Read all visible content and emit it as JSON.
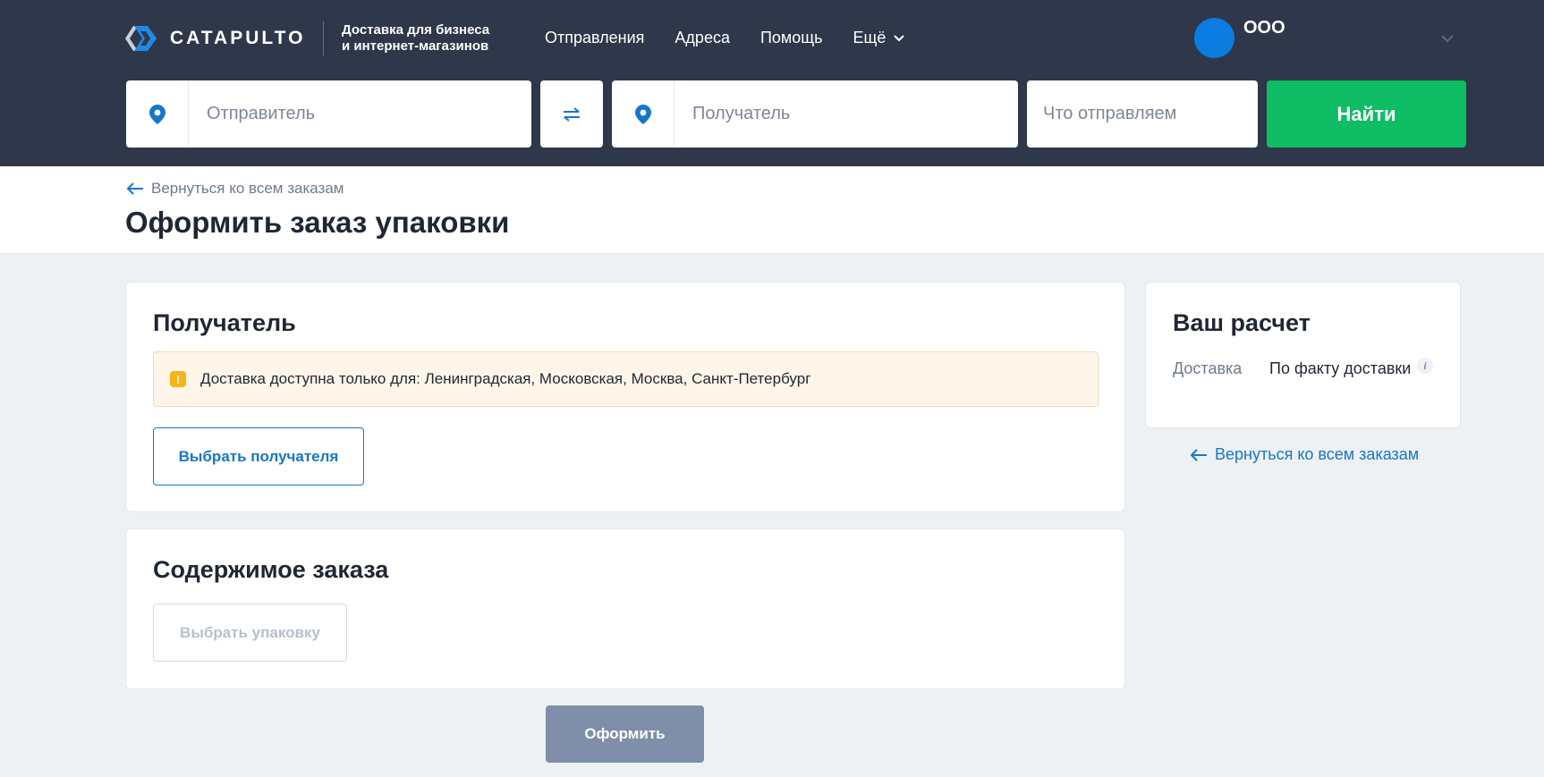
{
  "header": {
    "logo_text": "CATAPULTO",
    "tagline_line1": "Доставка для бизнеса",
    "tagline_line2": "и интернет-магазинов",
    "nav": [
      {
        "label": "Отправления"
      },
      {
        "label": "Адреса"
      },
      {
        "label": "Помощь"
      },
      {
        "label": "Ещё",
        "icon": "chevron-down-icon"
      }
    ],
    "account": {
      "company": "ООО",
      "icon": "chevron-down-icon"
    }
  },
  "search": {
    "sender_placeholder": "Отправитель",
    "recipient_placeholder": "Получатель",
    "what_placeholder": "Что отправляем",
    "find_label": "Найти",
    "pin_icon": "map-pin-icon",
    "swap_icon": "swap-arrows-icon"
  },
  "page": {
    "back_label": "Вернуться ко всем заказам",
    "title": "Оформить заказ упаковки"
  },
  "recipient_card": {
    "title": "Получатель",
    "notice": "Доставка доступна только для: Ленинградская, Московская, Москва, Санкт-Петербург",
    "notice_icon": "!",
    "choose_button": "Выбрать получателя"
  },
  "contents_card": {
    "title": "Содержимое заказа",
    "choose_button": "Выбрать упаковку",
    "choose_disabled": true
  },
  "calc_card": {
    "title": "Ваш расчет",
    "delivery_label": "Доставка",
    "delivery_value": "По факту доставки",
    "info_icon": "i"
  },
  "sidebar": {
    "back_label": "Вернуться ко всем заказам"
  },
  "submit_label": "Оформить",
  "colors": {
    "header_bg": "#2e384a",
    "accent_blue": "#1676c9",
    "find_green": "#0fbd64",
    "submit_disabled": "#7f8fa9",
    "notice_bg": "#fff5e9",
    "warn_yellow": "#f7b416"
  }
}
